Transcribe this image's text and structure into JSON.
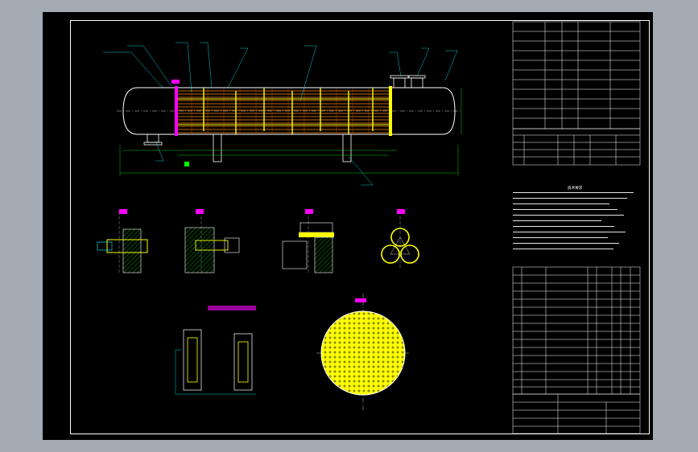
{
  "colors": {
    "background": "#000000",
    "outside": "#a3acb5",
    "frame": "#ffffff",
    "shell": "#ffffff",
    "tubes": "#ff8800",
    "baffles": "#ffff00",
    "dimension": "#00ff00",
    "leader": "#00ffff",
    "hatch": "#00a000",
    "bolt": "#0000ff",
    "tube_sheet": "#ffff00",
    "section_mark": "#ff00ff"
  },
  "drawing": {
    "views": [
      {
        "name": "main-elevation",
        "kind": "horizontal-heat-exchanger"
      },
      {
        "name": "detail-1",
        "kind": "tube-to-tubesheet-joint"
      },
      {
        "name": "detail-2",
        "kind": "tie-rod-joint"
      },
      {
        "name": "detail-3",
        "kind": "baffle-joint"
      },
      {
        "name": "detail-4",
        "kind": "triangular-tube-layout"
      },
      {
        "name": "detail-5",
        "kind": "support-saddle"
      },
      {
        "name": "tubesheet-layout",
        "kind": "tube-hole-pattern"
      }
    ],
    "tech_notes_title": "技术要求"
  }
}
